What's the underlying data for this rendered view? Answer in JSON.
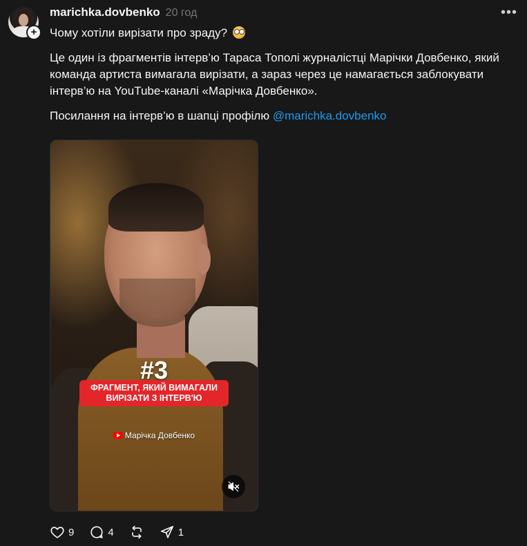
{
  "post": {
    "username": "marichka.dovbenko",
    "timestamp": "20 год",
    "title_line": "Чому хотіли вирізати про зраду?",
    "paragraph": "Це один із фрагментів інтерв’ю Тараса Тополі журналістці Марічки Довбенко, який команда артиста вимагала вирізати, а зараз через це намагається заблокувати інтерв’ю на YouTube-каналі «Марічка Довбенко».",
    "link_prefix": "Посилання на інтерв’ю в шапці профілю ",
    "mention": "@marichka.dovbenko",
    "more_label": "•••",
    "follow_label": "+"
  },
  "video": {
    "number": "#3",
    "banner_line1": "ФРАГМЕНТ, ЯКИЙ ВИМАГАЛИ",
    "banner_line2": "ВИРІЗАТИ З ІНТЕРВ'Ю",
    "credit": "Марічка Довбенко",
    "muted": true
  },
  "actions": {
    "likes": "9",
    "comments": "4",
    "repost": "",
    "shares": "1"
  },
  "colors": {
    "background": "#181818",
    "mention": "#1d9bf0",
    "banner": "#e3262a",
    "muted_text": "#777777"
  },
  "icons": [
    "plus-icon",
    "more-icon",
    "emoji-icon",
    "youtube-icon",
    "mute-icon",
    "heart-icon",
    "comment-icon",
    "repost-icon",
    "share-icon"
  ]
}
